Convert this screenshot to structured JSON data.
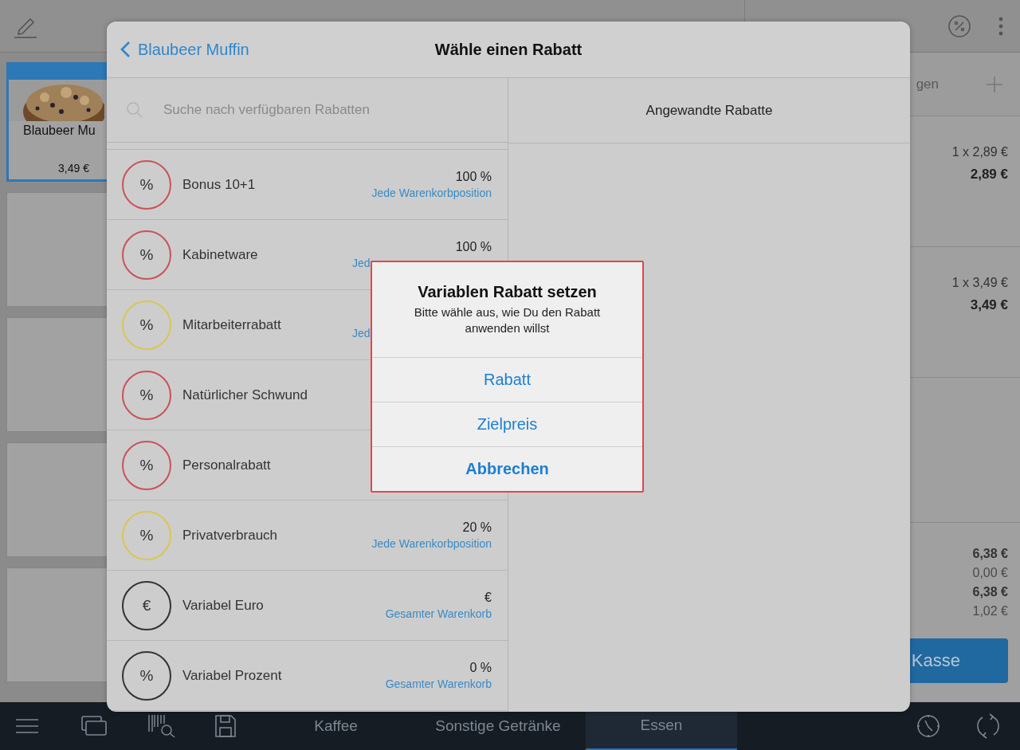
{
  "products": [
    {
      "name": "Blaubeer Mu",
      "price": "3,49 €",
      "selected": true,
      "kind": "picture"
    },
    {
      "selected": false
    },
    {
      "selected": false
    },
    {
      "selected": false
    },
    {
      "selected": false
    }
  ],
  "cart": {
    "add_label": "gen",
    "items": [
      {
        "quantity_price": "1 x 2,89 €",
        "total": "2,89 €"
      },
      {
        "quantity_price": "1 x 3,49 €",
        "total": "3,49 €"
      }
    ],
    "totals": [
      {
        "value": "6,38 €",
        "emphasis": true
      },
      {
        "value": "0,00 €",
        "emphasis": false
      },
      {
        "value": "6,38 €",
        "emphasis": true
      },
      {
        "value": "1,02 €",
        "emphasis": false
      }
    ],
    "checkout_button": "Kasse"
  },
  "bottom_bar": {
    "tabs": [
      {
        "label": "Kaffee",
        "selected": false
      },
      {
        "label": "Sonstige Getränke",
        "selected": false
      },
      {
        "label": "Essen",
        "selected": true
      }
    ]
  },
  "modal": {
    "back_label": "Blaubeer Muffin",
    "title": "Wähle einen Rabatt",
    "search": {
      "placeholder": "Suche nach verfügbaren Rabatten"
    },
    "applied_header": "Angewandte Rabatte",
    "discounts": [
      {
        "symbol": "%",
        "color": "#c9525b",
        "name": "Bonus 10+1",
        "value": "100 %",
        "scope": "Jede Warenkorbposition"
      },
      {
        "symbol": "%",
        "color": "#c9525b",
        "name": "Kabinetware",
        "value": "100 %",
        "scope": "Jed",
        "scope_cut": true
      },
      {
        "symbol": "%",
        "color": "#d9c654",
        "name": "Mitarbeiterrabatt",
        "scope": "Jed",
        "scope_cut": true
      },
      {
        "symbol": "%",
        "color": "#c9525b",
        "name": "Natürlicher Schwund"
      },
      {
        "symbol": "%",
        "color": "#c9525b",
        "name": "Personalrabatt"
      },
      {
        "symbol": "%",
        "color": "#d9c654",
        "name": "Privatverbrauch",
        "value": "20 %",
        "scope": "Jede Warenkorbposition"
      },
      {
        "symbol": "€",
        "color": "#333333",
        "name": "Variabel Euro",
        "value": "€",
        "scope": "Gesamter Warenkorb"
      },
      {
        "symbol": "%",
        "color": "#333333",
        "name": "Variabel Prozent",
        "value": "0 %",
        "scope": "Gesamter Warenkorb"
      }
    ]
  },
  "alert": {
    "title": "Variablen Rabatt setzen",
    "message": "Bitte wähle aus, wie Du den Rabatt anwenden willst",
    "highlighted": true,
    "buttons": [
      {
        "label": "Rabatt",
        "kind": "default"
      },
      {
        "label": "Zielpreis",
        "kind": "default"
      },
      {
        "label": "Abbrechen",
        "kind": "cancel"
      }
    ]
  }
}
